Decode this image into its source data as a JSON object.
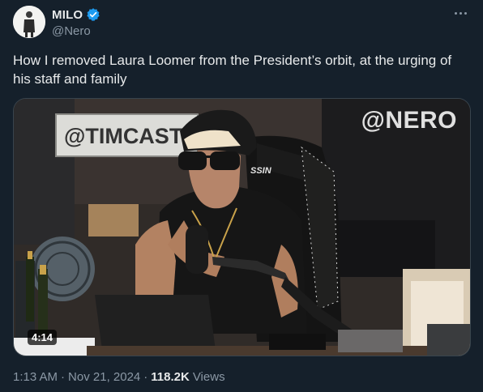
{
  "author": {
    "display_name": "MILO",
    "handle": "@Nero",
    "verified_icon": "verified-badge-icon",
    "avatar_icon": "avatar"
  },
  "more_icon": "more-options-icon",
  "tweet": {
    "text": "How I removed Laura Loomer from the President’s orbit, at the urging of his staff and family"
  },
  "media": {
    "watermark": "@NERO",
    "sign_text": "@TIMCASTI",
    "chair_text": "SSIN",
    "duration": "4:14"
  },
  "meta": {
    "time": "1:13 AM",
    "sep1": "·",
    "date": "Nov 21, 2024",
    "sep2": "·",
    "views_count": "118.2K",
    "views_label": "Views"
  },
  "colors": {
    "background": "#15202b",
    "text_primary": "#e7e9ea",
    "text_secondary": "#8b98a5",
    "verified_blue": "#1d9bf0"
  }
}
